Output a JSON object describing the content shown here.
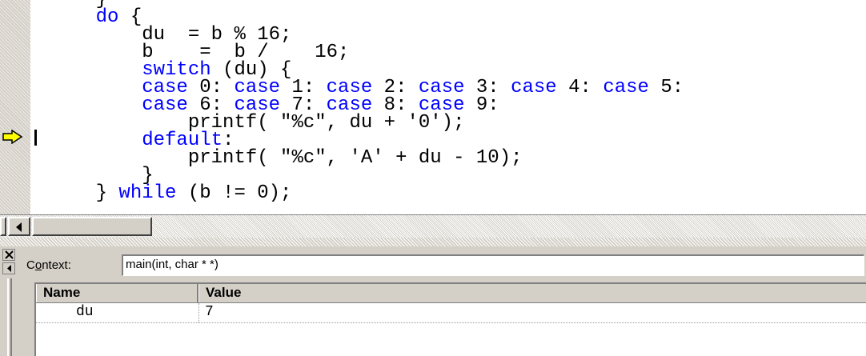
{
  "editor": {
    "lines": [
      "    } ",
      "    do {",
      "        du  = b % 16;",
      "        b    =  b /    16;",
      "        switch (du) {",
      "        case 0: case 1: case 2: case 3: case 4: case 5:",
      "        case 6: case 7: case 8: case 9:",
      "            printf( \"%c\", du + '0');",
      "        default:",
      "            printf( \"%c\", 'A' + du - 10);",
      "        }",
      "    } while (b != 0);"
    ],
    "keywords": [
      "do",
      "switch",
      "case",
      "default",
      "while"
    ],
    "current_line_index": 7,
    "keyword_color": "#0000ff",
    "arrow_color": "#ffff00"
  },
  "context": {
    "label": "Context:",
    "value": "main(int, char * *)"
  },
  "variables": {
    "columns": [
      "Name",
      "Value"
    ],
    "rows": [
      {
        "name": "du",
        "value": "7"
      }
    ]
  },
  "icons": {
    "execution_pointer": "yellow-right-arrow-icon",
    "close": "close-x-icon",
    "scroll_left": "left-triangle-icon"
  }
}
